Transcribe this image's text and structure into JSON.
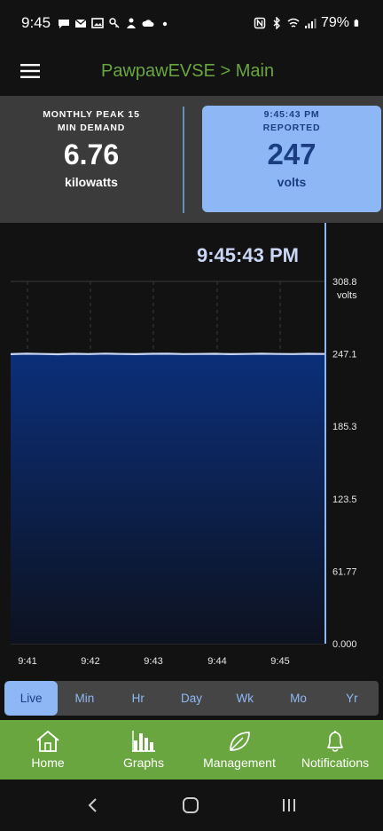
{
  "status_bar": {
    "time": "9:45",
    "battery": "79%",
    "notification_icons": [
      "chat-icon",
      "mail-icon",
      "image-icon",
      "key-icon",
      "weather-icon",
      "cloud-icon",
      "dot-icon"
    ],
    "system_icons": [
      "nfc-icon",
      "bluetooth-icon",
      "wifi-icon",
      "signal-icon",
      "battery-icon"
    ]
  },
  "app_bar": {
    "title": "PawpawEVSE > Main"
  },
  "summary": {
    "peak_caption_line1": "MONTHLY PEAK 15",
    "peak_caption_line2": "MIN DEMAND",
    "peak_value": "6.76",
    "peak_unit": "kilowatts",
    "reported_time": "9:45:43 PM",
    "reported_caption": "REPORTED",
    "reported_value": "247",
    "reported_unit": "volts"
  },
  "chart_data": {
    "type": "area",
    "current_time_label": "9:45:43 PM",
    "x_ticks": [
      "9:41",
      "9:42",
      "9:43",
      "9:44",
      "9:45"
    ],
    "y_ticks": [
      "0.000",
      "61.77",
      "123.5",
      "185.3",
      "247.1",
      "308.8"
    ],
    "y_tick_values": [
      0,
      61.77,
      123.5,
      185.3,
      247.1,
      308.8
    ],
    "ylabel": "volts",
    "ylim": [
      0,
      308.8
    ],
    "series": [
      {
        "values": [
          246.8,
          247.2,
          247.0,
          246.7,
          247.1,
          246.9,
          247.3,
          247.0,
          246.8,
          247.1,
          247.2,
          246.9,
          247.0,
          247.1,
          246.8,
          247.0,
          247.2,
          247.0,
          246.9,
          247.1,
          247.0
        ]
      }
    ],
    "line_color": "#c9d6f5",
    "fill_color_top": "#0b2f7a",
    "fill_color_bottom": "#0d1220"
  },
  "range_tabs": [
    {
      "label": "Live",
      "active": true
    },
    {
      "label": "Min",
      "active": false
    },
    {
      "label": "Hr",
      "active": false
    },
    {
      "label": "Day",
      "active": false
    },
    {
      "label": "Wk",
      "active": false
    },
    {
      "label": "Mo",
      "active": false
    },
    {
      "label": "Yr",
      "active": false
    }
  ],
  "bottom_nav": [
    {
      "label": "Home",
      "icon": "home-icon"
    },
    {
      "label": "Graphs",
      "icon": "bar-chart-icon"
    },
    {
      "label": "Management",
      "icon": "leaf-icon"
    },
    {
      "label": "Notifications",
      "icon": "bell-icon"
    }
  ],
  "colors": {
    "accent_green": "#6aa640",
    "accent_blue": "#8eb8f5",
    "dark_blue": "#1b3e82"
  }
}
